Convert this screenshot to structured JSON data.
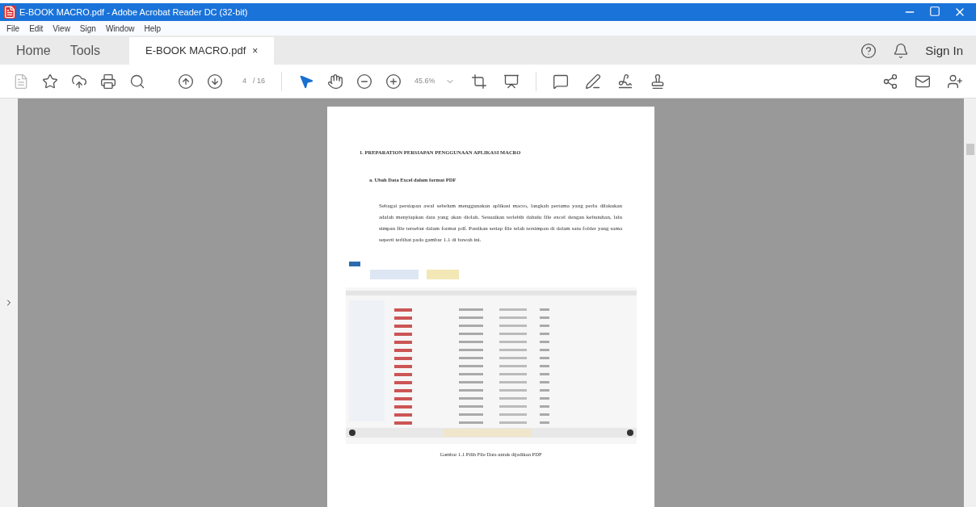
{
  "window": {
    "title": "E-BOOK MACRO.pdf - Adobe Acrobat Reader DC (32-bit)"
  },
  "menu": [
    "File",
    "Edit",
    "View",
    "Sign",
    "Window",
    "Help"
  ],
  "tabs": [
    {
      "label": "Home",
      "selected": false,
      "kind": "nav"
    },
    {
      "label": "Tools",
      "selected": false,
      "kind": "nav"
    },
    {
      "label": "E-BOOK MACRO.pdf",
      "selected": true,
      "kind": "doc",
      "close": "×"
    }
  ],
  "sign_in": "Sign In",
  "page_nav": {
    "current": "4",
    "total": "/ 16"
  },
  "zoom": {
    "value": "45.6%"
  },
  "document": {
    "heading": "1.  PREPARATION PERSIAPAN PENGGUNAAN APLIKASI MACRO",
    "subheading": "a.  Ubah Data Excel dalam format PDF",
    "paragraph": "Sebagai persiapan awal sebelum menggunakan aplikasi macro, langkah pertama yang perlu dilakukan adalah menyiapkan data yang akan diolah. Sesuaikan terlebih dahulu file excel dengan kebutuhan, lalu simpan file tersebut dalam format pdf. Pastikan setiap file telah tersimpan di dalam satu folder yang sama seperti terlihat pada gambar 1.1 di bawah ini.",
    "caption": "Gambar 1.1 Pilih File Data untuk dijadikan PDF"
  }
}
